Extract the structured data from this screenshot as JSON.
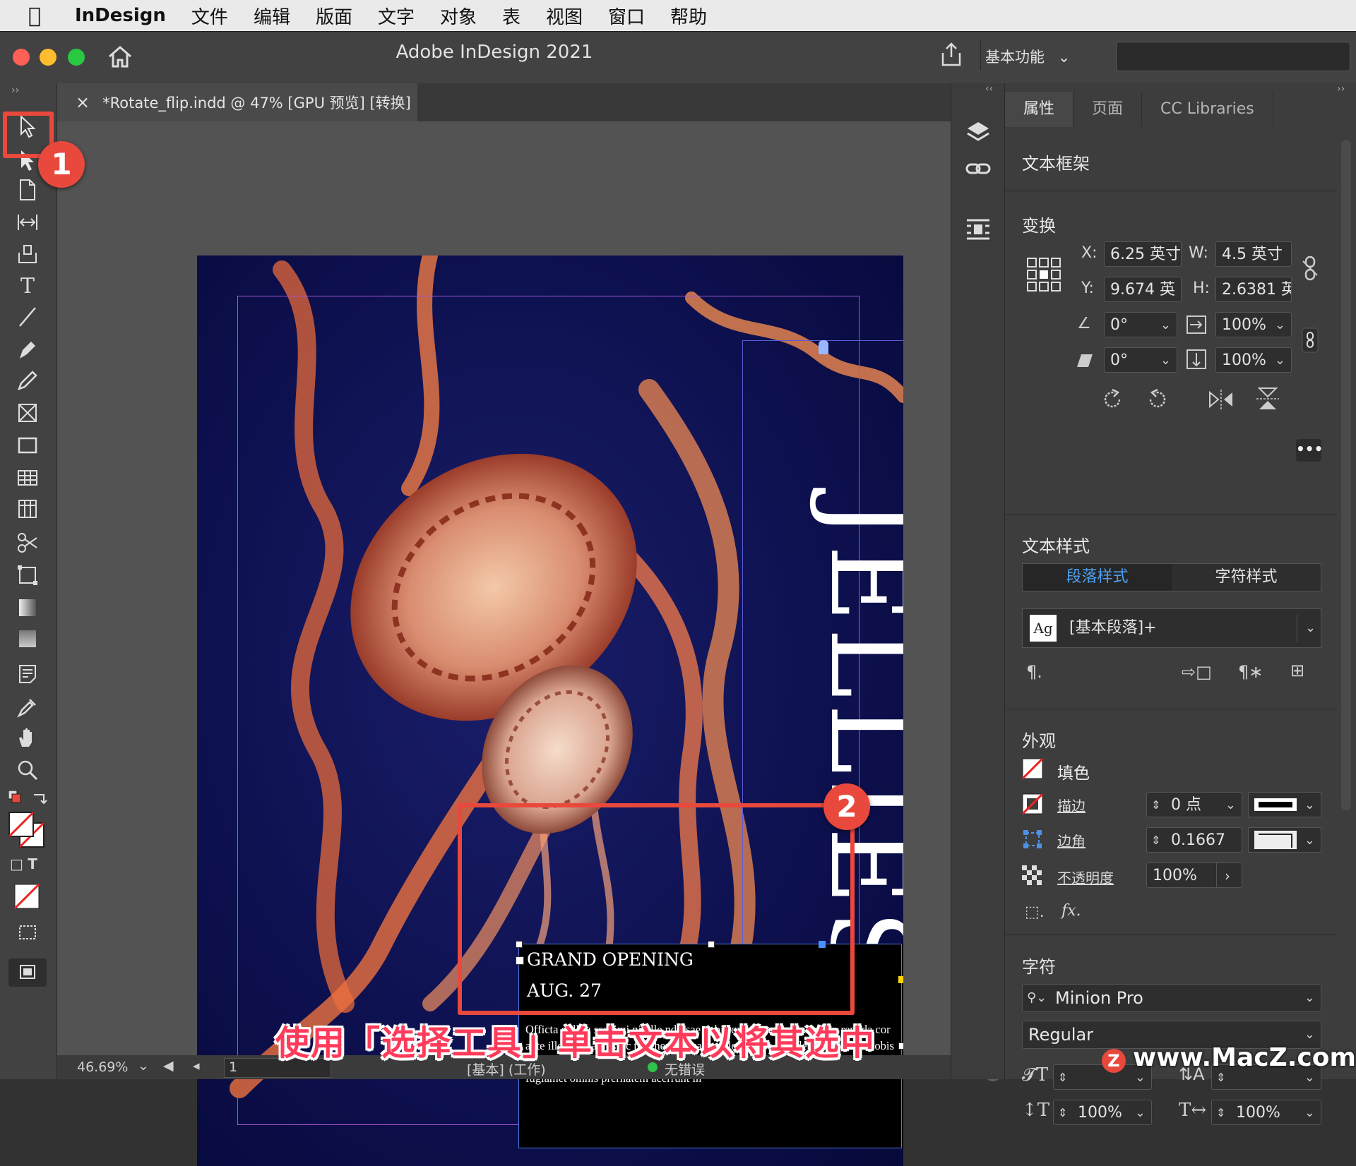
{
  "menubar": {
    "app_name": "InDesign",
    "items": [
      "文件",
      "编辑",
      "版面",
      "文字",
      "对象",
      "表",
      "视图",
      "窗口",
      "帮助"
    ]
  },
  "titlebar": {
    "title": "Adobe InDesign 2021",
    "workspace": "基本功能"
  },
  "document_tab": {
    "close": "×",
    "label": "*Rotate_flip.indd @ 47% [GPU 预览] [转换]"
  },
  "page_content": {
    "headline": "JELLIES",
    "grand_opening": "GRAND OPENING",
    "date": "AUG. 27",
    "body": "Officta dollita ssenimi nihille ndiosae debis qui occupient quam, in repuda cor aute illesse quamus. Ic te rehenda quatia dolorro rese-que debis eliquia is nobis minci cuscimus ulparch iliquat volest aut ut officias estius nonsedionet fugiamet omnis prernatem acerrunt in"
  },
  "panel": {
    "tabs": [
      "属性",
      "页面",
      "CC Libraries"
    ],
    "object_type": "文本框架",
    "transform": {
      "title": "变换",
      "x_label": "X:",
      "x": "6.25 英寸",
      "y_label": "Y:",
      "y": "9.674 英",
      "w_label": "W:",
      "w": "4.5 英寸",
      "h_label": "H:",
      "h": "2.6381 英",
      "rotate": "0°",
      "shear": "0°",
      "scale_x": "100%",
      "scale_y": "100%"
    },
    "text_style": {
      "title": "文本样式",
      "tab_paragraph": "段落样式",
      "tab_character": "字符样式",
      "ag": "Ag",
      "style_value": "[基本段落]+"
    },
    "appearance": {
      "title": "外观",
      "fill": "填色",
      "stroke": "描边",
      "stroke_value": "0 点",
      "corner": "边角",
      "corner_value": "0.1667",
      "opacity": "不透明度",
      "opacity_value": "100%",
      "fx": "fx."
    },
    "character": {
      "title": "字符",
      "font": "Minion Pro",
      "style": "Regular",
      "size": "",
      "leading": "",
      "vscale": "100%",
      "hscale": "100%"
    }
  },
  "statusbar": {
    "zoom": "46.69%",
    "page": "1",
    "style_info": "[基本] (工作)",
    "errors": "无错误"
  },
  "callouts": {
    "badge1": "1",
    "badge2": "2",
    "caption": "使用「选择工具」单击文本以将其选中",
    "watermark": "www.MacZ.com"
  },
  "colors": {
    "accent_red": "#e9483c",
    "caption_pink": "#ff3b5b",
    "active_tab_blue": "#4ea2f2"
  }
}
